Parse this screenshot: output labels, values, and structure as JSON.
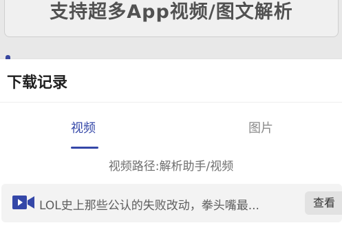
{
  "background": {
    "banner_text": "支持超多App视频/图文解析"
  },
  "sheet": {
    "title": "下载记录",
    "tabs": [
      {
        "label": "视频",
        "active": true
      },
      {
        "label": "图片",
        "active": false
      }
    ],
    "path_text": "视频路径:解析助手/视频",
    "records": [
      {
        "icon": "video-camera-icon",
        "title": "LOL史上那些公认的失败改动，拳头嘴最...",
        "action_label": "查看"
      }
    ]
  },
  "colors": {
    "accent": "#3447a8",
    "inactive_tab": "#8a8a8a",
    "record_bg": "#f3f3f3"
  }
}
